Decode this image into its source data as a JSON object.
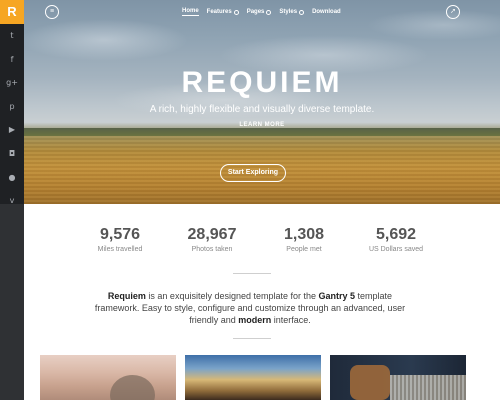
{
  "sidebar": {
    "logo": "R",
    "social": [
      {
        "icon": "twitter-icon",
        "glyph": "t"
      },
      {
        "icon": "facebook-icon",
        "glyph": "f"
      },
      {
        "icon": "google-plus-icon",
        "glyph": "g+"
      },
      {
        "icon": "pinterest-icon",
        "glyph": "p"
      },
      {
        "icon": "youtube-icon",
        "glyph": "▶"
      },
      {
        "icon": "instagram-icon",
        "glyph": "◘"
      },
      {
        "icon": "flickr-icon",
        "glyph": "●"
      },
      {
        "icon": "vine-icon",
        "glyph": "v"
      }
    ]
  },
  "nav": {
    "items": [
      {
        "label": "Home",
        "active": true,
        "has_dropdown": false
      },
      {
        "label": "Features",
        "active": false,
        "has_dropdown": true
      },
      {
        "label": "Pages",
        "active": false,
        "has_dropdown": true
      },
      {
        "label": "Styles",
        "active": false,
        "has_dropdown": true
      },
      {
        "label": "Download",
        "active": false,
        "has_dropdown": false
      }
    ]
  },
  "hero": {
    "title": "REQUIEM",
    "subtitle": "A rich, highly flexible and visually diverse template.",
    "learn_more": "LEARN MORE",
    "cta": "Start Exploring"
  },
  "stats": [
    {
      "value": "9,576",
      "label": "Miles travelled"
    },
    {
      "value": "28,967",
      "label": "Photos taken"
    },
    {
      "value": "1,308",
      "label": "People met"
    },
    {
      "value": "5,692",
      "label": "US Dollars saved"
    }
  ],
  "intro": {
    "brand": "Requiem",
    "part1": " is an exquisitely designed template for the ",
    "gantry": "Gantry 5",
    "part2": " template framework. Easy to style, configure and customize through an advanced, user friendly and ",
    "modern": "modern",
    "part3": " interface."
  },
  "colors": {
    "accent": "#f6a623",
    "sidebar": "#2f3134"
  }
}
